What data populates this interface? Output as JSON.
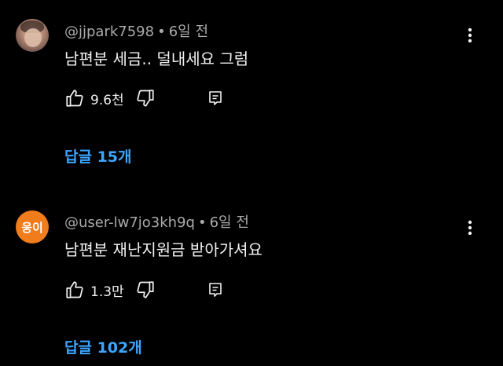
{
  "comments": [
    {
      "username": "@jjpark7598",
      "separator": "•",
      "time": "6일 전",
      "text": "남편분 세금.. 덜내세요 그럼",
      "likes": "9.6천",
      "reply_link": "답글 15개",
      "avatar_icon": "user-photo-avatar"
    },
    {
      "username": "@user-lw7jo3kh9q",
      "separator": "•",
      "time": "6일 전",
      "text": "남편분 재난지원금 받아가셔요",
      "likes": "1.3만",
      "reply_link": "답글 102개",
      "avatar_text": "웅이",
      "avatar_color": "#f07c1c"
    }
  ],
  "icons": {
    "like": "thumbs-up-icon",
    "dislike": "thumbs-down-icon",
    "reply": "reply-icon",
    "more": "more-vert-icon"
  },
  "colors": {
    "background": "#000000",
    "link": "#3ea6ff",
    "secondary_text": "#aaaaaa",
    "primary_text": "#f1f1f1"
  }
}
